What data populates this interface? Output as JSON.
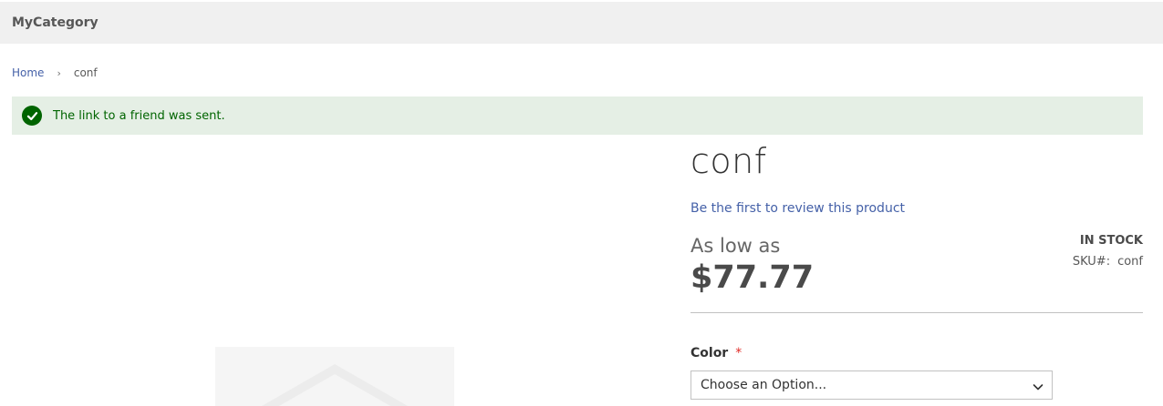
{
  "nav": {
    "category": "MyCategory"
  },
  "breadcrumbs": {
    "home": "Home",
    "separator": "›",
    "current": "conf"
  },
  "message": {
    "text": "The link to a friend was sent.",
    "type": "success"
  },
  "product": {
    "name": "conf",
    "review_link": "Be the first to review this product",
    "price_label": "As low as",
    "price": "$77.77",
    "stock": "IN STOCK",
    "sku_label": "SKU#:",
    "sku": "conf"
  },
  "options": {
    "color_label": "Color",
    "required_mark": "*",
    "color_selected": "Choose an Option..."
  },
  "icons": {
    "success": "check-circle-icon",
    "breadcrumb_sep": "chevron-right-icon",
    "select": "chevron-down-icon",
    "gallery": "image-placeholder-icon"
  },
  "colors": {
    "link": "#4561a8",
    "success_bg": "#e5efe5",
    "success_text": "#006400",
    "required": "#e02b27"
  }
}
